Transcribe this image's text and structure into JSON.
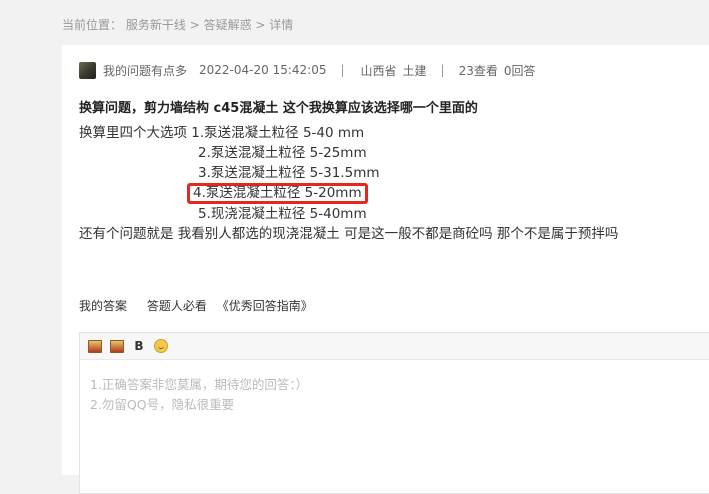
{
  "breadcrumb": {
    "prefix": "当前位置：",
    "items": [
      "服务新干线",
      "答疑解惑",
      "详情"
    ],
    "separator": " > "
  },
  "question": {
    "author": "我的问题有点多",
    "datetime": "2022-04-20 15:42:05",
    "location": "山西省",
    "category": "土建",
    "views": "23查看",
    "answers": "0回答",
    "title": "换算问题，剪力墙结构 c45混凝土 这个我换算应该选择哪一个里面的",
    "intro": "换算里四个大选项",
    "options": [
      "1.泵送混凝土粒径 5-40 mm",
      "2.泵送混凝土粒径 5-25mm",
      "3.泵送混凝土粒径 5-31.5mm",
      "4.泵送混凝土粒径 5-20mm",
      "5.现浇混凝土粒径 5-40mm"
    ],
    "followup": "还有个问题就是 我看别人都选的现浇混凝土 可是这一般不都是商砼吗  那个不是属于预拌吗"
  },
  "answer_section": {
    "my_answer": "我的答案",
    "must_read": "答题人必看",
    "guide_link": "《优秀回答指南》"
  },
  "editor": {
    "toolbar": [
      "image-icon",
      "image-icon",
      "bold",
      "emoji-icon"
    ],
    "bold_label": "B",
    "placeholder_line1": "1.正确答案非您莫属，期待您的回答：）",
    "placeholder_line2": "2.勿留QQ号，隐私很重要"
  }
}
